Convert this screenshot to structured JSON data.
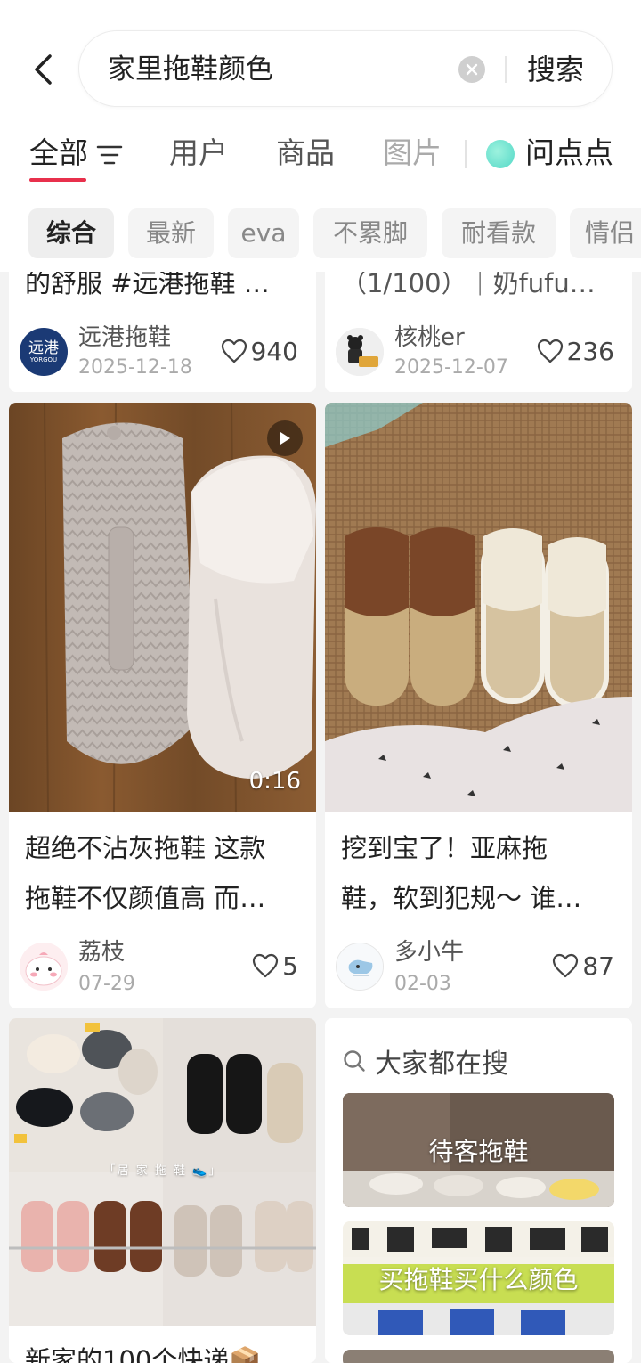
{
  "search": {
    "query": "家里拖鞋颜色",
    "button": "搜索"
  },
  "tabs": [
    {
      "label": "全部"
    },
    {
      "label": "用户"
    },
    {
      "label": "商品"
    },
    {
      "label": "图片"
    },
    {
      "label": "问点点"
    }
  ],
  "chips": [
    "综合",
    "最新",
    "eva",
    "不累脚",
    "耐看款",
    "情侣"
  ],
  "cards": [
    {
      "title": "的舒服 #远港拖鞋 …",
      "author": "远港拖鞋",
      "date": "2025-12-18",
      "likes": "940",
      "avatar_text": "远港",
      "avatar_sub": "YORGOU"
    },
    {
      "title": "（1/100）｜奶fufu…",
      "author": "核桃er",
      "date": "2025-12-07",
      "likes": "236"
    },
    {
      "title_lines": [
        "超绝不沾灰拖鞋 这款",
        "拖鞋不仅颜值高 而…"
      ],
      "author": "荔枝",
      "date": "07-29",
      "likes": "5",
      "duration": "0:16"
    },
    {
      "title_lines": [
        "挖到宝了！亚麻拖",
        "鞋，软到犯规～ 谁…"
      ],
      "author": "多小牛",
      "date": "02-03",
      "likes": "87"
    },
    {
      "title": "新家的100个快递📦",
      "overlay": "「居 家 拖 鞋 👟」"
    }
  ],
  "hot_searches": {
    "title": "大家都在搜",
    "items": [
      "待客拖鞋",
      "买拖鞋买什么颜色"
    ]
  },
  "colors": {
    "accent": "#e8304c",
    "background": "#f3f3f3"
  }
}
